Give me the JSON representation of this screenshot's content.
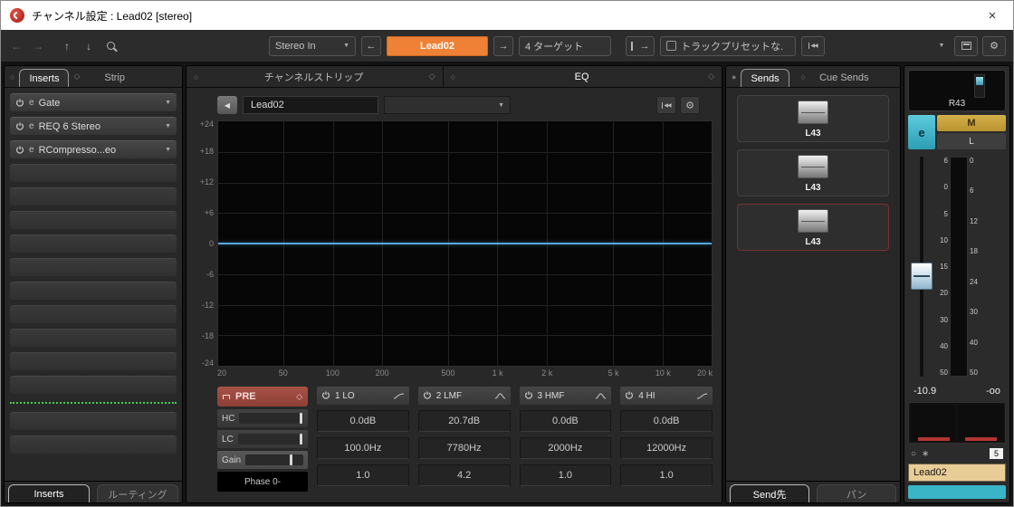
{
  "window": {
    "title": "チャンネル設定 : Lead02 [stereo]"
  },
  "icons": {
    "close": "×",
    "back": "←",
    "forward": "→",
    "up": "↑",
    "down": "↓",
    "dropdown": "▼",
    "circle": "○",
    "bullet": "●",
    "diamond": "◇",
    "gear": "⚙",
    "skip_back": "◀◀",
    "e": "e",
    "asterisk": "∗",
    "left_arrow": "◀"
  },
  "toolbar": {
    "input_routing": "Stereo In",
    "channel_name": "Lead02",
    "targets": "4 ターゲット",
    "track_preset": "トラックプリセットな."
  },
  "inserts": {
    "tab": "Inserts",
    "tab_strip": "Strip",
    "slots": [
      {
        "name": "Gate"
      },
      {
        "name": "REQ 6 Stereo"
      },
      {
        "name": "RCompresso...eo"
      }
    ],
    "bottom_tabs": [
      "Inserts",
      "ルーティング"
    ]
  },
  "strip": {
    "header": "チャンネルストリップ"
  },
  "eq": {
    "header": "EQ",
    "channel_label": "Lead02",
    "db_labels": [
      "+24",
      "+18",
      "+12",
      "+6",
      "0",
      "-6",
      "-12",
      "-18",
      "-24"
    ],
    "freq_labels": [
      "20",
      "50",
      "100",
      "200",
      "500",
      "1 k",
      "2 k",
      "5 k",
      "10 k",
      "20 k"
    ],
    "pre": {
      "label": "PRE",
      "hc": "HC",
      "lc": "LC",
      "gain": "Gain",
      "phase": "Phase 0-"
    },
    "bands": [
      {
        "label": "1 LO",
        "gain": "0.0dB",
        "freq": "100.0Hz",
        "q": "1.0"
      },
      {
        "label": "2 LMF",
        "gain": "20.7dB",
        "freq": "7780Hz",
        "q": "4.2"
      },
      {
        "label": "3 HMF",
        "gain": "0.0dB",
        "freq": "2000Hz",
        "q": "1.0"
      },
      {
        "label": "4 HI",
        "gain": "0.0dB",
        "freq": "12000Hz",
        "q": "1.0"
      }
    ]
  },
  "sends": {
    "tab": "Sends",
    "tab_cue": "Cue Sends",
    "slots": [
      {
        "value": "L43"
      },
      {
        "value": "L43"
      },
      {
        "value": "L43"
      }
    ],
    "bottom_tabs": [
      "Send先",
      "パン"
    ]
  },
  "fader": {
    "pan": "R43",
    "mute": "M",
    "listen": "L",
    "edit": "e",
    "scale_left": [
      "6",
      "0",
      "5",
      "10",
      "15",
      "20",
      "30",
      "40",
      "50"
    ],
    "scale_right": [
      "0",
      "6",
      "12",
      "18",
      "24",
      "30",
      "40",
      "50"
    ],
    "level": "-10.9",
    "peak": "-oo",
    "channel_number": "5",
    "channel_name": "Lead02"
  },
  "colors": {
    "accent_orange": "#ee8135",
    "eq_curve": "#57a5d8",
    "mute_yellow": "#c9a23a",
    "edit_cyan": "#3ab5c8",
    "name_bg": "#e9cd96",
    "pre_red": "#9c4a40",
    "send_alert_border": "#7d2f2f",
    "insert_meter_green": "#3fd04a"
  }
}
